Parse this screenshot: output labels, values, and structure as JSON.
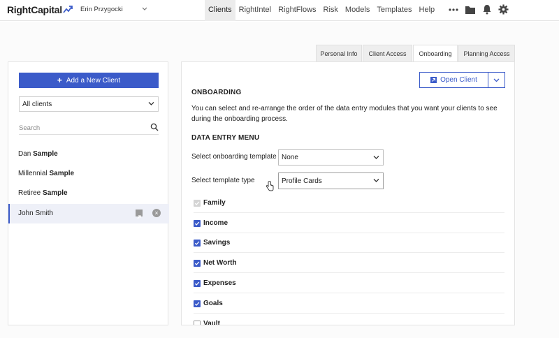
{
  "app": {
    "logo_text": "RightCapital",
    "user_name": "Erin Przygocki"
  },
  "nav": {
    "items": [
      {
        "label": "Clients",
        "active": true
      },
      {
        "label": "RightIntel",
        "active": false
      },
      {
        "label": "RightFlows",
        "active": false
      },
      {
        "label": "Risk",
        "active": false
      },
      {
        "label": "Models",
        "active": false
      },
      {
        "label": "Templates",
        "active": false
      },
      {
        "label": "Help",
        "active": false
      }
    ],
    "icons": [
      "more-icon",
      "folder-icon",
      "bell-icon",
      "gear-icon"
    ]
  },
  "sidebar": {
    "add_button_label": "Add a New Client",
    "filter_value": "All clients",
    "search_placeholder": "Search",
    "clients": [
      {
        "first": "Dan",
        "last": "Sample",
        "selected": false
      },
      {
        "first": "Millennial",
        "last": "Sample",
        "selected": false
      },
      {
        "first": "Retiree",
        "last": "Sample",
        "selected": false
      },
      {
        "first": "John",
        "last": "Smith",
        "selected": true
      }
    ]
  },
  "tabs": [
    {
      "label": "Personal Info",
      "active": false
    },
    {
      "label": "Client Access",
      "active": false
    },
    {
      "label": "Onboarding",
      "active": true
    },
    {
      "label": "Planning Access",
      "active": false
    }
  ],
  "main": {
    "open_client_label": "Open Client",
    "section_title": "ONBOARDING",
    "description": "You can select and re-arrange the order of the data entry modules that you want your clients to see during the onboarding process.",
    "menu_title": "DATA ENTRY MENU",
    "onboarding_template_label": "Select onboarding template",
    "onboarding_template_value": "None",
    "template_type_label": "Select template type",
    "template_type_value": "Profile Cards",
    "modules": [
      {
        "label": "Family",
        "state": "disabled"
      },
      {
        "label": "Income",
        "state": "checked"
      },
      {
        "label": "Savings",
        "state": "checked"
      },
      {
        "label": "Net Worth",
        "state": "checked"
      },
      {
        "label": "Expenses",
        "state": "checked"
      },
      {
        "label": "Goals",
        "state": "checked"
      },
      {
        "label": "Vault",
        "state": "unchecked"
      }
    ]
  },
  "colors": {
    "accent": "#3b5bc9",
    "selected_row": "#eef0f8"
  }
}
